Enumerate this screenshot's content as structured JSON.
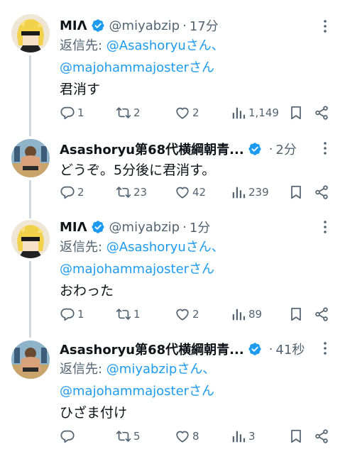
{
  "tweets": [
    {
      "name": "MIΛ",
      "handle": "@miyabzip",
      "time": "17分",
      "reply_prefix": "返信先: ",
      "reply_line1_mention": "@Asashoryu",
      "reply_line1_suffix": "さん、",
      "reply_line2_mention": "@majohammajoster",
      "reply_line2_suffix": "さん",
      "text": "君消す",
      "stats": {
        "replies": "1",
        "retweets": "2",
        "likes": "2",
        "views": "1,149"
      }
    },
    {
      "name": "Asashoryu第68代横綱朝青...",
      "time": "2分",
      "text": "どうぞ。5分後に君消す。",
      "stats": {
        "replies": "2",
        "retweets": "23",
        "likes": "42",
        "views": "239"
      }
    },
    {
      "name": "MIΛ",
      "handle": "@miyabzip",
      "time": "1分",
      "reply_prefix": "返信先: ",
      "reply_line1_mention": "@Asashoryu",
      "reply_line1_suffix": "さん、",
      "reply_line2_mention": "@majohammajoster",
      "reply_line2_suffix": "さん",
      "text": "おわった",
      "stats": {
        "replies": "1",
        "retweets": "1",
        "likes": "2",
        "views": "89"
      }
    },
    {
      "name": "Asashoryu第68代横綱朝青...",
      "time": "41秒",
      "reply_prefix": "返信先: ",
      "reply_line1_mention": "@miyabzip",
      "reply_line1_suffix": "さん、",
      "reply_line2_mention": "@majohammajoster",
      "reply_line2_suffix": "さん",
      "text": "ひざま付け",
      "stats": {
        "retweets": "5",
        "likes": "8",
        "views": "3"
      }
    }
  ],
  "dot": "·",
  "icons": {
    "verified": "verified-badge-icon",
    "more": "more-options-icon",
    "reply": "reply-icon",
    "retweet": "retweet-icon",
    "like": "heart-icon",
    "views": "views-icon",
    "bookmark": "bookmark-icon",
    "share": "share-icon"
  },
  "colors": {
    "link": "#1d9bf0",
    "secondary": "#536471",
    "verified": "#1d9bf0",
    "thread_line": "#cfd9de"
  }
}
